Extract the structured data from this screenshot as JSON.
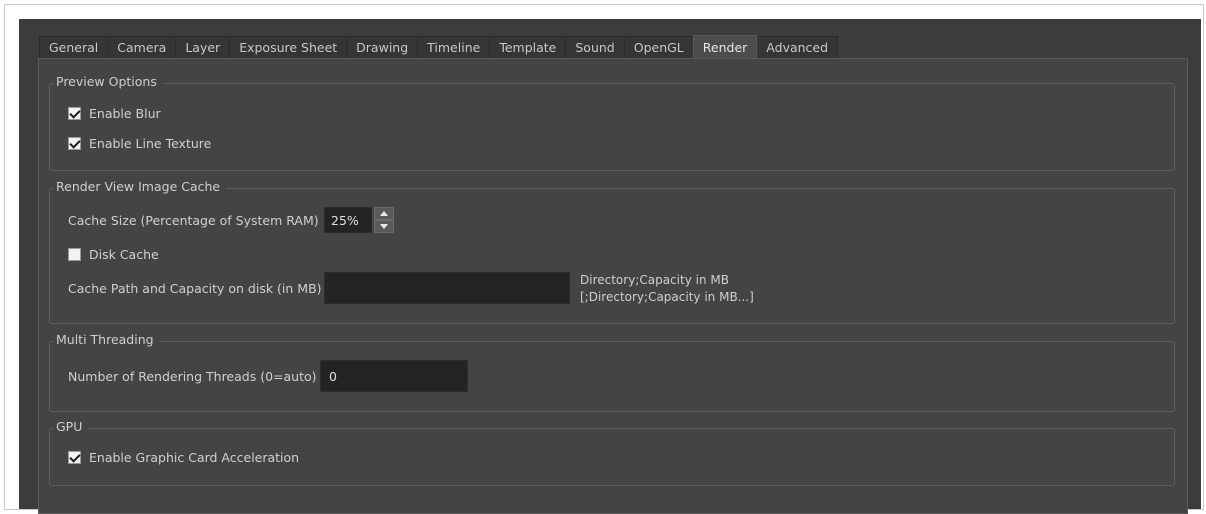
{
  "tabs": [
    {
      "label": "General"
    },
    {
      "label": "Camera"
    },
    {
      "label": "Layer"
    },
    {
      "label": "Exposure Sheet"
    },
    {
      "label": "Drawing"
    },
    {
      "label": "Timeline"
    },
    {
      "label": "Template"
    },
    {
      "label": "Sound"
    },
    {
      "label": "OpenGL"
    },
    {
      "label": "Render",
      "active": true
    },
    {
      "label": "Advanced"
    }
  ],
  "preview_options": {
    "title": "Preview Options",
    "enable_blur": {
      "label": "Enable Blur",
      "checked": true
    },
    "enable_line_texture": {
      "label": "Enable Line Texture",
      "checked": true
    }
  },
  "render_cache": {
    "title": "Render View Image Cache",
    "cache_size_label": "Cache Size (Percentage of System RAM)",
    "cache_size_value": "25%",
    "disk_cache": {
      "label": "Disk Cache",
      "checked": false
    },
    "cache_path_label": "Cache Path and Capacity on disk (in MB)",
    "cache_path_value": "",
    "hint_line1": "Directory;Capacity in MB",
    "hint_line2": "[;Directory;Capacity in MB...]"
  },
  "multi_threading": {
    "title": "Multi Threading",
    "threads_label": "Number of Rendering Threads (0=auto)",
    "threads_value": "0"
  },
  "gpu": {
    "title": "GPU",
    "enable_gpu": {
      "label": "Enable Graphic Card Acceleration",
      "checked": true
    }
  },
  "colors": {
    "panel_bg": "#3c3c3c",
    "pane_bg": "#444444",
    "field_bg": "#232323",
    "text": "#d0d0d0"
  }
}
